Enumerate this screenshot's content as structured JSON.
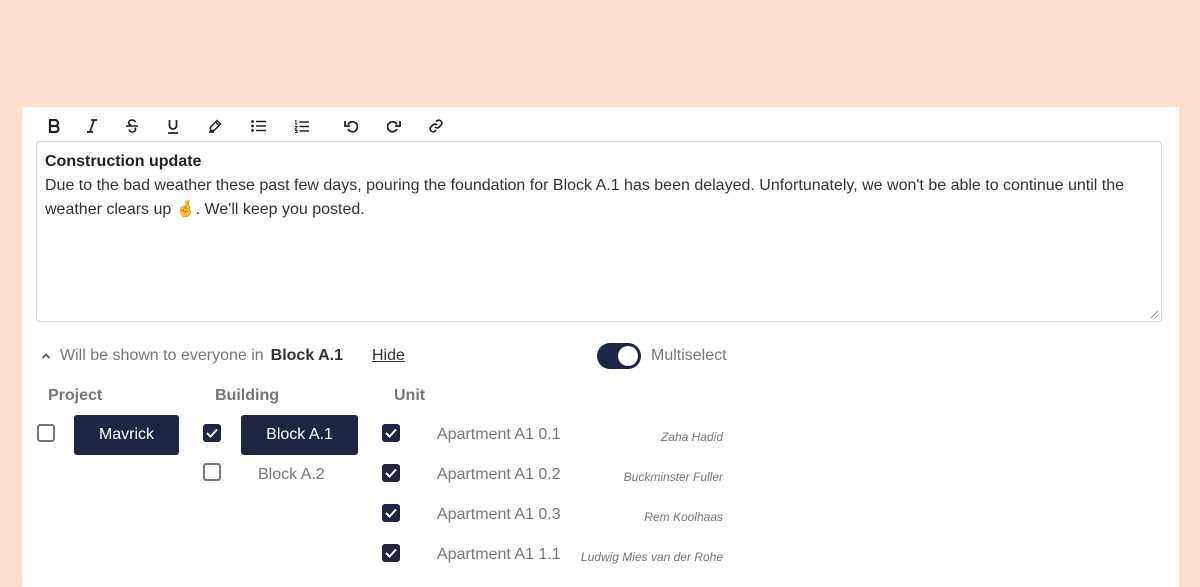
{
  "toolbar": {
    "buttons": [
      {
        "name": "bold",
        "icon": "bold-icon"
      },
      {
        "name": "italic",
        "icon": "italic-icon"
      },
      {
        "name": "strikethrough",
        "icon": "strikethrough-icon"
      },
      {
        "name": "underline",
        "icon": "underline-icon"
      },
      {
        "name": "highlight",
        "icon": "highlighter-icon"
      },
      {
        "name": "bullet-list",
        "icon": "bullet-list-icon"
      },
      {
        "name": "numbered-list",
        "icon": "numbered-list-icon"
      },
      {
        "name": "undo",
        "icon": "undo-icon"
      },
      {
        "name": "redo",
        "icon": "redo-icon"
      },
      {
        "name": "link",
        "icon": "link-icon"
      }
    ]
  },
  "editor": {
    "title": "Construction update",
    "body": "Due to the bad weather these past few days, pouring the foundation for Block A.1 has been delayed. Unfortunately, we won't be able to continue until the weather clears up 🤞. We'll keep you posted."
  },
  "visibility": {
    "prefix": "Will be shown to everyone in",
    "target": "Block A.1",
    "hide_label": "Hide"
  },
  "multiselect": {
    "label": "Multiselect",
    "enabled": true
  },
  "columns": {
    "project": "Project",
    "building": "Building",
    "unit": "Unit"
  },
  "projects": [
    {
      "label": "Mavrick",
      "checked": false,
      "selected": true
    }
  ],
  "buildings": [
    {
      "label": "Block A.1",
      "checked": true,
      "selected": true
    },
    {
      "label": "Block A.2",
      "checked": false,
      "selected": false
    }
  ],
  "units": [
    {
      "name": "Apartment A1 0.1",
      "owner": "Zaha Hadid",
      "checked": true
    },
    {
      "name": "Apartment A1 0.2",
      "owner": "Buckminster Fuller",
      "checked": true
    },
    {
      "name": "Apartment A1 0.3",
      "owner": "Rem Koolhaas",
      "checked": true
    },
    {
      "name": "Apartment A1 1.1",
      "owner": "Ludwig Mies van der Rohe",
      "checked": true
    }
  ],
  "colors": {
    "background": "#fbe0cf",
    "accent": "#1f2544",
    "muted_text": "#777777"
  }
}
